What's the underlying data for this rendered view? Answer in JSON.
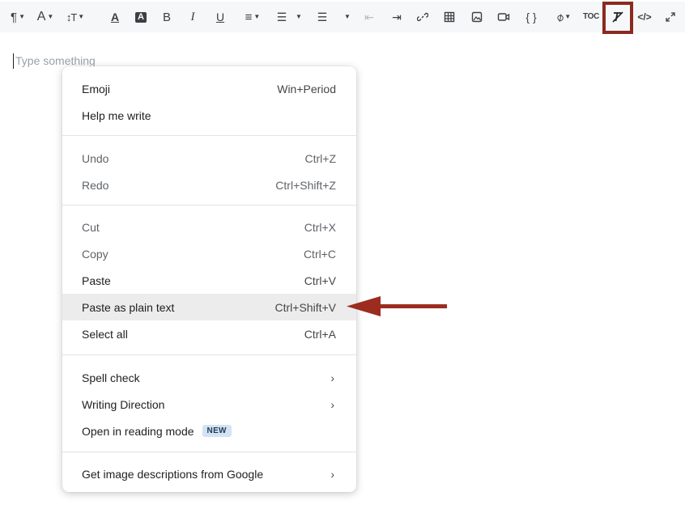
{
  "toolbar": {
    "toc_label": "TOC",
    "code_braces": "{ }",
    "highlight_color": "#8b2a1f"
  },
  "editor": {
    "placeholder": "Type something"
  },
  "context_menu": {
    "items": [
      {
        "label": "Emoji",
        "shortcut": "Win+Period"
      },
      {
        "label": "Help me write",
        "shortcut": ""
      },
      {
        "label": "Undo",
        "shortcut": "Ctrl+Z"
      },
      {
        "label": "Redo",
        "shortcut": "Ctrl+Shift+Z"
      },
      {
        "label": "Cut",
        "shortcut": "Ctrl+X"
      },
      {
        "label": "Copy",
        "shortcut": "Ctrl+C"
      },
      {
        "label": "Paste",
        "shortcut": "Ctrl+V"
      },
      {
        "label": "Paste as plain text",
        "shortcut": "Ctrl+Shift+V"
      },
      {
        "label": "Select all",
        "shortcut": "Ctrl+A"
      },
      {
        "label": "Spell check",
        "shortcut": ""
      },
      {
        "label": "Writing Direction",
        "shortcut": ""
      },
      {
        "label": "Open in reading mode",
        "shortcut": "",
        "badge": "NEW"
      },
      {
        "label": "Get image descriptions from Google",
        "shortcut": ""
      }
    ],
    "submenu_chevron": "›"
  },
  "annotation": {
    "arrow_color": "#9b2c1f"
  }
}
